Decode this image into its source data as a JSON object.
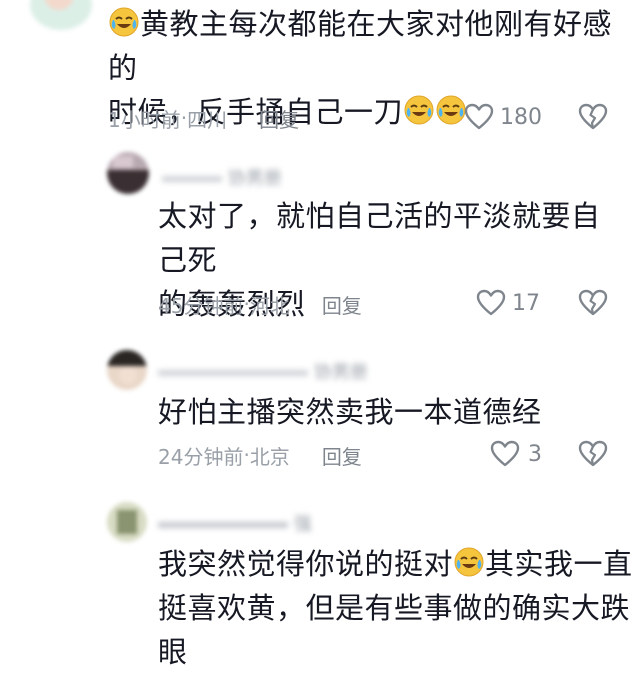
{
  "comments": [
    {
      "text_line1": "黄教主每次都能在大家对他刚有好感的",
      "text_line2": "时候，反手捅自己一刀",
      "time": "1小时前",
      "location": "四川",
      "reply_label": "回复",
      "likes": "180"
    },
    {
      "username": "协男册",
      "text_line1": "太对了，就怕自己活的平淡就要自己死",
      "text_line2": "的轰轰烈烈",
      "time": "45分钟前",
      "location": "河北",
      "reply_label": "回复",
      "likes": "17"
    },
    {
      "username": "协男册",
      "text_line1": "好怕主播突然卖我一本道德经",
      "time": "24分钟前",
      "location": "北京",
      "reply_label": "回复",
      "likes": "3"
    },
    {
      "username": "强",
      "text_line1_a": "我突然觉得你说的挺对",
      "text_line1_b": "其实我一直",
      "text_line2": "挺喜欢黄，但是有些事做的确实大跌眼"
    }
  ],
  "separator": " · ",
  "icons": {
    "like": "heart-outline-icon",
    "dislike": "broken-heart-icon",
    "emoji": "laugh-cry-emoji-icon"
  },
  "colors": {
    "text": "#161823",
    "meta": "#9aa0a8",
    "emoji_face": "#f6c53e",
    "emoji_tear": "#4fb3ef"
  }
}
